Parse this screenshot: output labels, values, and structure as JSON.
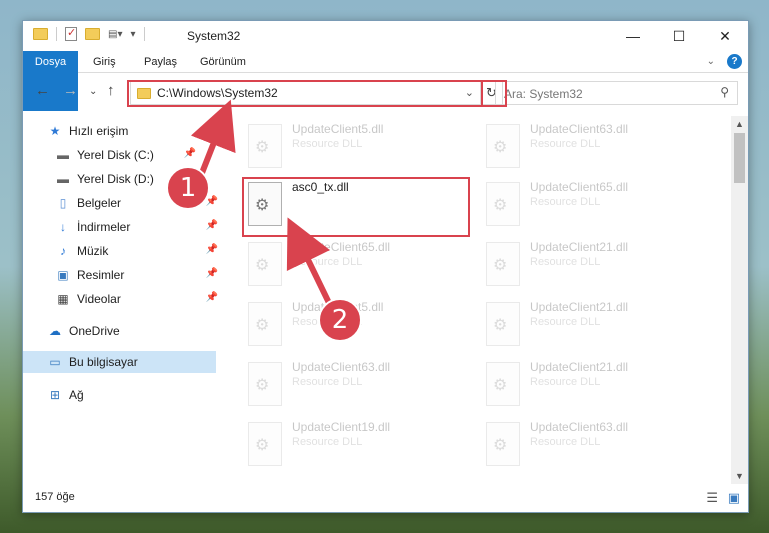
{
  "window": {
    "title": "System32",
    "controls": {
      "minimize": "—",
      "maximize": "☐",
      "close": "✕"
    }
  },
  "ribbon": {
    "tabs": [
      {
        "label": "Dosya"
      },
      {
        "label": "Giriş"
      },
      {
        "label": "Paylaş"
      },
      {
        "label": "Görünüm"
      }
    ],
    "help": "?"
  },
  "nav": {
    "address": "C:\\Windows\\System32",
    "search_placeholder": "Ara: System32"
  },
  "sidebar": {
    "items": [
      {
        "label": "Hızlı erişim",
        "icon": "star-icon"
      },
      {
        "label": "Yerel Disk (C:)",
        "icon": "drive-icon"
      },
      {
        "label": "Yerel Disk (D:)",
        "icon": "drive-icon"
      },
      {
        "label": "Belgeler",
        "icon": "documents-icon"
      },
      {
        "label": "İndirmeler",
        "icon": "downloads-icon"
      },
      {
        "label": "Müzik",
        "icon": "music-icon"
      },
      {
        "label": "Resimler",
        "icon": "pictures-icon"
      },
      {
        "label": "Videolar",
        "icon": "videos-icon"
      },
      {
        "label": "OneDrive",
        "icon": "cloud-icon"
      },
      {
        "label": "Bu bilgisayar",
        "icon": "computer-icon"
      },
      {
        "label": "Ağ",
        "icon": "network-icon"
      }
    ]
  },
  "files": [
    {
      "name": "UpdateClient5.dll",
      "desc": "Resource DLL"
    },
    {
      "name": "UpdateClient63.dll",
      "desc": "Resource DLL"
    },
    {
      "name": "asc0_tx.dll",
      "desc": ""
    },
    {
      "name": "UpdateClient65.dll",
      "desc": "Resource DLL"
    },
    {
      "name": "UpdateClient65.dll",
      "desc": "Resource DLL"
    },
    {
      "name": "UpdateClient21.dll",
      "desc": "Resource DLL"
    },
    {
      "name": "UpdateClient5.dll",
      "desc": "Resource DLL"
    },
    {
      "name": "UpdateClient21.dll",
      "desc": "Resource DLL"
    },
    {
      "name": "UpdateClient63.dll",
      "desc": "Resource DLL"
    },
    {
      "name": "UpdateClient21.dll",
      "desc": "Resource DLL"
    },
    {
      "name": "UpdateClient19.dll",
      "desc": "Resource DLL"
    },
    {
      "name": "UpdateClient63.dll",
      "desc": "Resource DLL"
    }
  ],
  "status": {
    "count": "157 öğe"
  },
  "callouts": [
    "1",
    "2"
  ]
}
